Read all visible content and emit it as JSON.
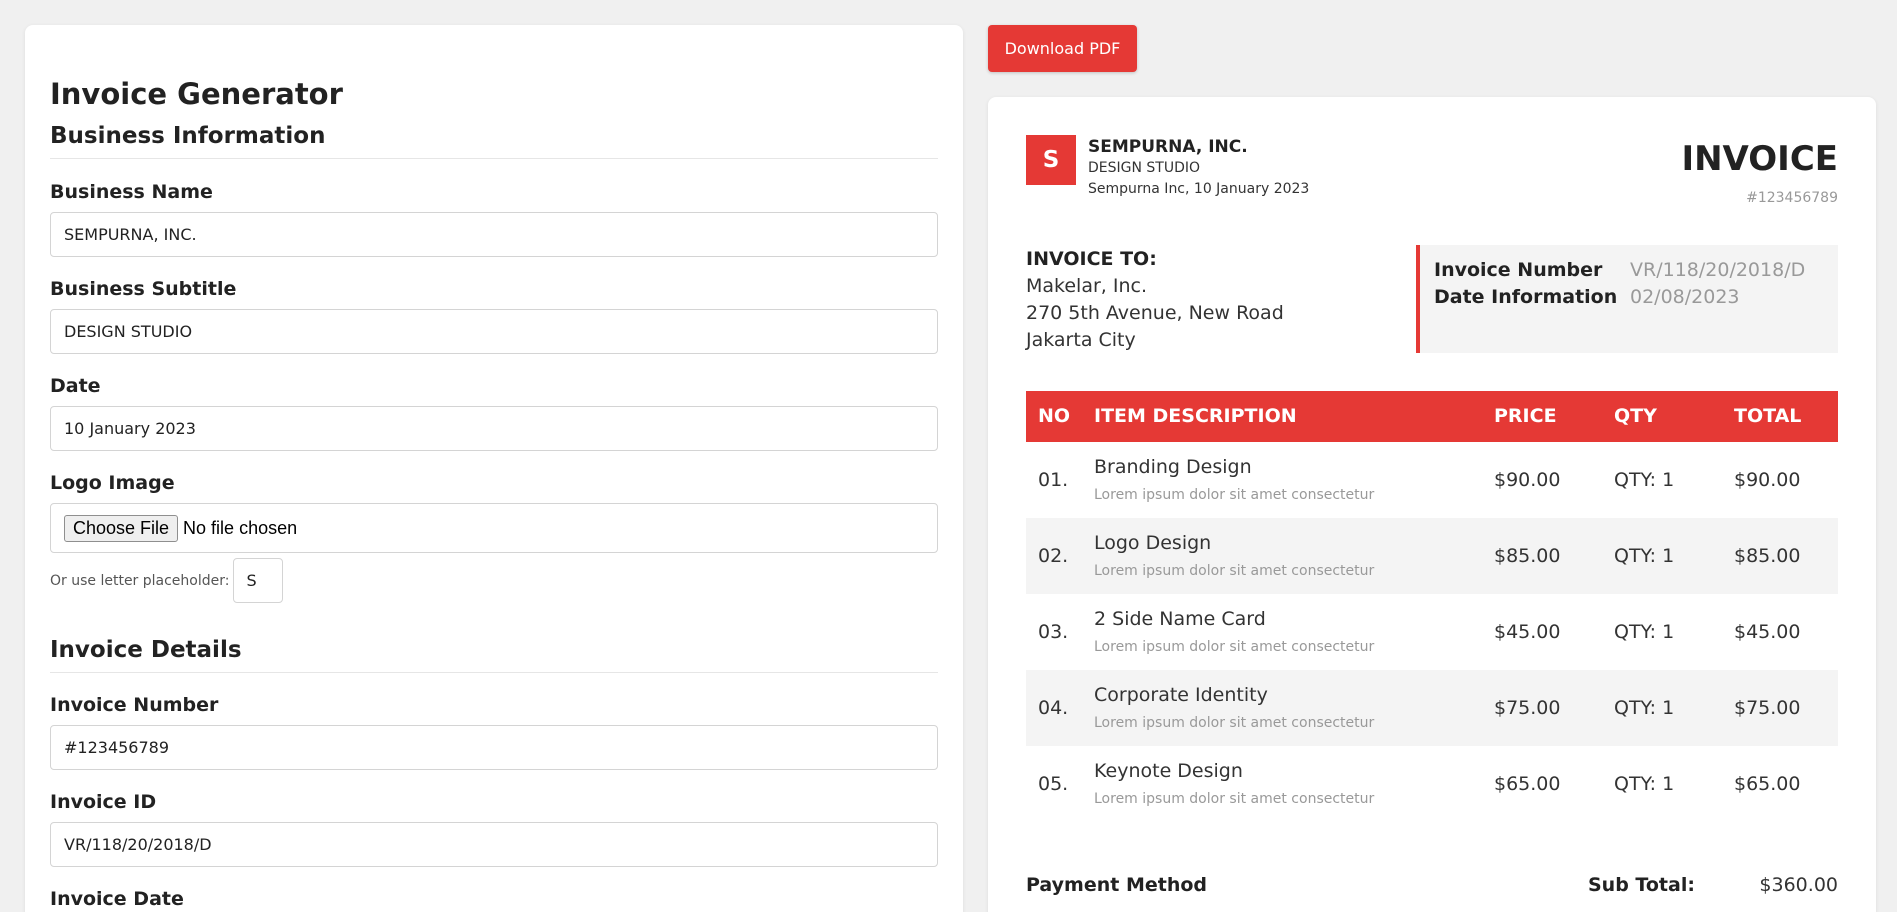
{
  "form": {
    "title": "Invoice Generator",
    "business_section": "Business Information",
    "business_name_label": "Business Name",
    "business_name_value": "SEMPURNA, INC.",
    "business_subtitle_label": "Business Subtitle",
    "business_subtitle_value": "DESIGN STUDIO",
    "date_label": "Date",
    "date_value": "10 January 2023",
    "logo_label": "Logo Image",
    "file_button": "Choose File",
    "file_status": "No file chosen",
    "placeholder_label": "Or use letter placeholder:",
    "placeholder_value": "S",
    "invoice_section": "Invoice Details",
    "invoice_number_label": "Invoice Number",
    "invoice_number_value": "#123456789",
    "invoice_id_label": "Invoice ID",
    "invoice_id_value": "VR/118/20/2018/D",
    "invoice_date_label": "Invoice Date"
  },
  "download_label": "Download PDF",
  "invoice": {
    "logo_letter": "S",
    "business_name": "SEMPURNA, INC.",
    "business_subtitle": "DESIGN STUDIO",
    "business_line": "Sempurna Inc, 10 January 2023",
    "title": "INVOICE",
    "number": "#123456789",
    "to_label": "INVOICE TO:",
    "to_lines": [
      "Makelar, Inc.",
      "270 5th Avenue, New Road",
      "Jakarta City"
    ],
    "info": {
      "number_label": "Invoice Number",
      "number_value": "VR/118/20/2018/D",
      "date_label": "Date Information",
      "date_value": "02/08/2023"
    },
    "columns": [
      "NO",
      "ITEM DESCRIPTION",
      "PRICE",
      "QTY",
      "TOTAL"
    ],
    "items": [
      {
        "no": "01.",
        "name": "Branding Design",
        "desc": "Lorem ipsum dolor sit amet consectetur",
        "price": "$90.00",
        "qty": "QTY: 1",
        "total": "$90.00"
      },
      {
        "no": "02.",
        "name": "Logo Design",
        "desc": "Lorem ipsum dolor sit amet consectetur",
        "price": "$85.00",
        "qty": "QTY: 1",
        "total": "$85.00"
      },
      {
        "no": "03.",
        "name": "2 Side Name Card",
        "desc": "Lorem ipsum dolor sit amet consectetur",
        "price": "$45.00",
        "qty": "QTY: 1",
        "total": "$45.00"
      },
      {
        "no": "04.",
        "name": "Corporate Identity",
        "desc": "Lorem ipsum dolor sit amet consectetur",
        "price": "$75.00",
        "qty": "QTY: 1",
        "total": "$75.00"
      },
      {
        "no": "05.",
        "name": "Keynote Design",
        "desc": "Lorem ipsum dolor sit amet consectetur",
        "price": "$65.00",
        "qty": "QTY: 1",
        "total": "$65.00"
      }
    ],
    "payment_method_label": "Payment Method",
    "subtotal_label": "Sub Total:",
    "subtotal_value": "$360.00"
  },
  "colors": {
    "accent": "#e53935",
    "background": "#f0f0f0",
    "row_alt": "#f4f4f4"
  }
}
